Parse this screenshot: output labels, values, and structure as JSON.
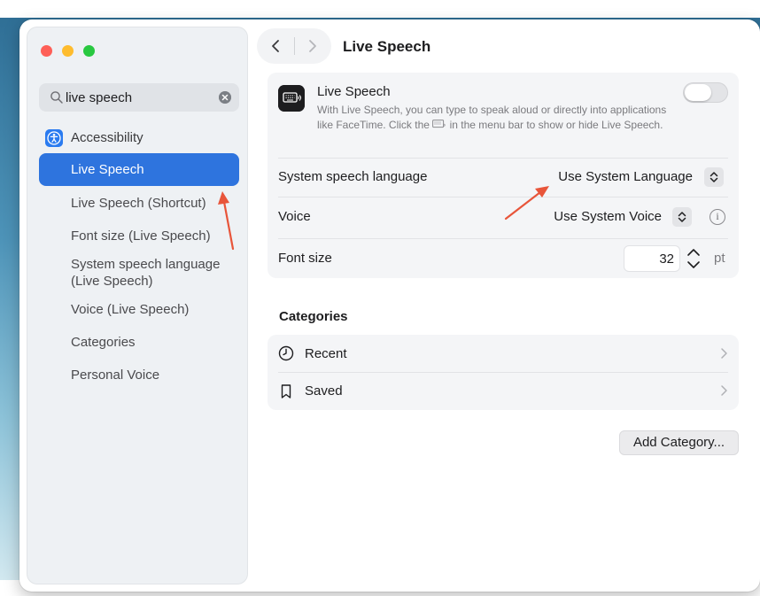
{
  "window": {
    "title": "Live Speech",
    "nav": {
      "back_icon": "chevron-left-icon",
      "forward_icon": "chevron-right-icon"
    }
  },
  "sidebar": {
    "search": {
      "value": "live speech",
      "placeholder": "Search"
    },
    "category": {
      "label": "Accessibility",
      "icon": "accessibility-icon",
      "icon_color": "#2a7bf0"
    },
    "items": [
      {
        "label": "Live Speech",
        "selected": true
      },
      {
        "label": "Live Speech (Shortcut)",
        "selected": false
      },
      {
        "label": "Font size (Live Speech)",
        "selected": false
      },
      {
        "label": "System speech language (Live Speech)",
        "selected": false
      },
      {
        "label": "Voice (Live Speech)",
        "selected": false
      },
      {
        "label": "Categories",
        "selected": false
      },
      {
        "label": "Personal Voice",
        "selected": false
      }
    ],
    "selected_color": "#2e74de"
  },
  "live_speech": {
    "title": "Live Speech",
    "description": "With Live Speech, you can type to speak aloud or directly into applications like FaceTime. Click the",
    "description_end": "in the menu bar to show or hide Live Speech.",
    "enabled": false
  },
  "settings": {
    "system_speech_language": {
      "label": "System speech language",
      "value": "Use System Language"
    },
    "voice": {
      "label": "Voice",
      "value": "Use System Voice"
    },
    "font_size": {
      "label": "Font size",
      "value": "32",
      "unit": "pt"
    }
  },
  "categories": {
    "title": "Categories",
    "items": [
      {
        "label": "Recent",
        "icon": "clock-icon"
      },
      {
        "label": "Saved",
        "icon": "bookmark-icon"
      }
    ],
    "add_button": "Add Category..."
  },
  "annotations": {
    "arrow_color": "#e8553a"
  }
}
